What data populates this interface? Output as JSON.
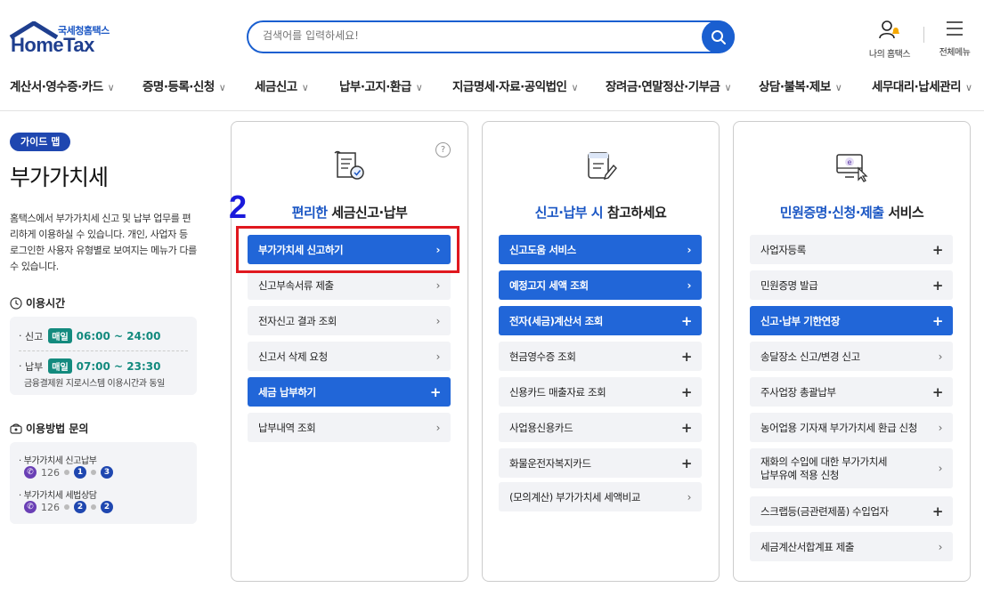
{
  "header": {
    "logo_sub": "국세청홈택스",
    "logo_main": "HomeTax",
    "search_placeholder": "검색어를 입력하세요!",
    "my_hometax": "나의 홈택스",
    "full_menu": "전체메뉴"
  },
  "gnb": [
    "계산서·영수증·카드",
    "증명·등록·신청",
    "세금신고",
    "납부·고지·환급",
    "지급명세·자료·공익법인",
    "장려금·연말정산·기부금",
    "상담·불복·제보",
    "세무대리·납세관리"
  ],
  "left": {
    "badge": "가이드 맵",
    "title": "부가가치세",
    "desc": "홈택스에서 부가가치세 신고 및 납부 업무를 편리하게 이용하실 수 있습니다. 개인, 사업자 등 로그인한 사용자 유형별로 보여지는 메뉴가 다를 수 있습니다.",
    "hours_title": "이용시간",
    "hours": [
      {
        "label": "신고",
        "pill": "매일",
        "time": "06:00 ~ 24:00"
      },
      {
        "label": "납부",
        "pill": "매일",
        "time": "07:00 ~ 23:30"
      }
    ],
    "hours_note": "금융결제원 지로시스템 이용시간과 동일",
    "inquiry_title": "이용방법 문의",
    "inquiries": [
      {
        "label": "부가가치세 신고납부",
        "number": "126",
        "keys": [
          "1",
          "3"
        ]
      },
      {
        "label": "부가가치세 세법상담",
        "number": "126",
        "keys": [
          "2",
          "2"
        ]
      }
    ]
  },
  "cards": [
    {
      "title_hl": "편리한",
      "title_rest": " 세금신고·납부",
      "items": [
        {
          "label": "부가가치세 신고하기",
          "style": "blue",
          "mark": "›"
        },
        {
          "label": "신고부속서류 제출",
          "style": "gray",
          "mark": "›"
        },
        {
          "label": "전자신고 결과 조회",
          "style": "gray",
          "mark": "›"
        },
        {
          "label": "신고서 삭제 요청",
          "style": "gray",
          "mark": "›"
        },
        {
          "label": "세금 납부하기",
          "style": "blue",
          "mark": "+"
        },
        {
          "label": "납부내역 조회",
          "style": "gray",
          "mark": "›"
        }
      ]
    },
    {
      "title_hl": "신고·납부 시",
      "title_rest": " 참고하세요",
      "items": [
        {
          "label": "신고도움 서비스",
          "style": "blue",
          "mark": "›"
        },
        {
          "label": "예정고지 세액 조회",
          "style": "blue",
          "mark": "›"
        },
        {
          "label": "전자(세금)계산서 조회",
          "style": "blue",
          "mark": "+"
        },
        {
          "label": "현금영수증 조회",
          "style": "gray",
          "mark": "+"
        },
        {
          "label": "신용카드 매출자료 조회",
          "style": "gray",
          "mark": "+"
        },
        {
          "label": "사업용신용카드",
          "style": "gray",
          "mark": "+"
        },
        {
          "label": "화물운전자복지카드",
          "style": "gray",
          "mark": "+"
        },
        {
          "label": "(모의계산) 부가가치세 세액비교",
          "style": "gray",
          "mark": "›"
        }
      ]
    },
    {
      "title_hl": "민원증명·신청·제출",
      "title_rest": " 서비스",
      "items": [
        {
          "label": "사업자등록",
          "style": "gray",
          "mark": "+"
        },
        {
          "label": "민원증명 발급",
          "style": "gray",
          "mark": "+"
        },
        {
          "label": "신고·납부 기한연장",
          "style": "blue",
          "mark": "+"
        },
        {
          "label": "송달장소 신고/변경 신고",
          "style": "gray",
          "mark": "›"
        },
        {
          "label": "주사업장 총괄납부",
          "style": "gray",
          "mark": "+"
        },
        {
          "label": "농어업용 기자재 부가가치세 환급 신청",
          "style": "gray",
          "mark": "›"
        },
        {
          "label": "재화의 수입에 대한 부가가치세\n납부유예 적용 신청",
          "style": "gray",
          "mark": "›"
        },
        {
          "label": "스크랩등(금관련제품) 수입업자",
          "style": "gray",
          "mark": "+"
        },
        {
          "label": "세금계산서합계표 제출",
          "style": "gray",
          "mark": "›"
        }
      ]
    }
  ],
  "annotation": {
    "step": "2"
  }
}
